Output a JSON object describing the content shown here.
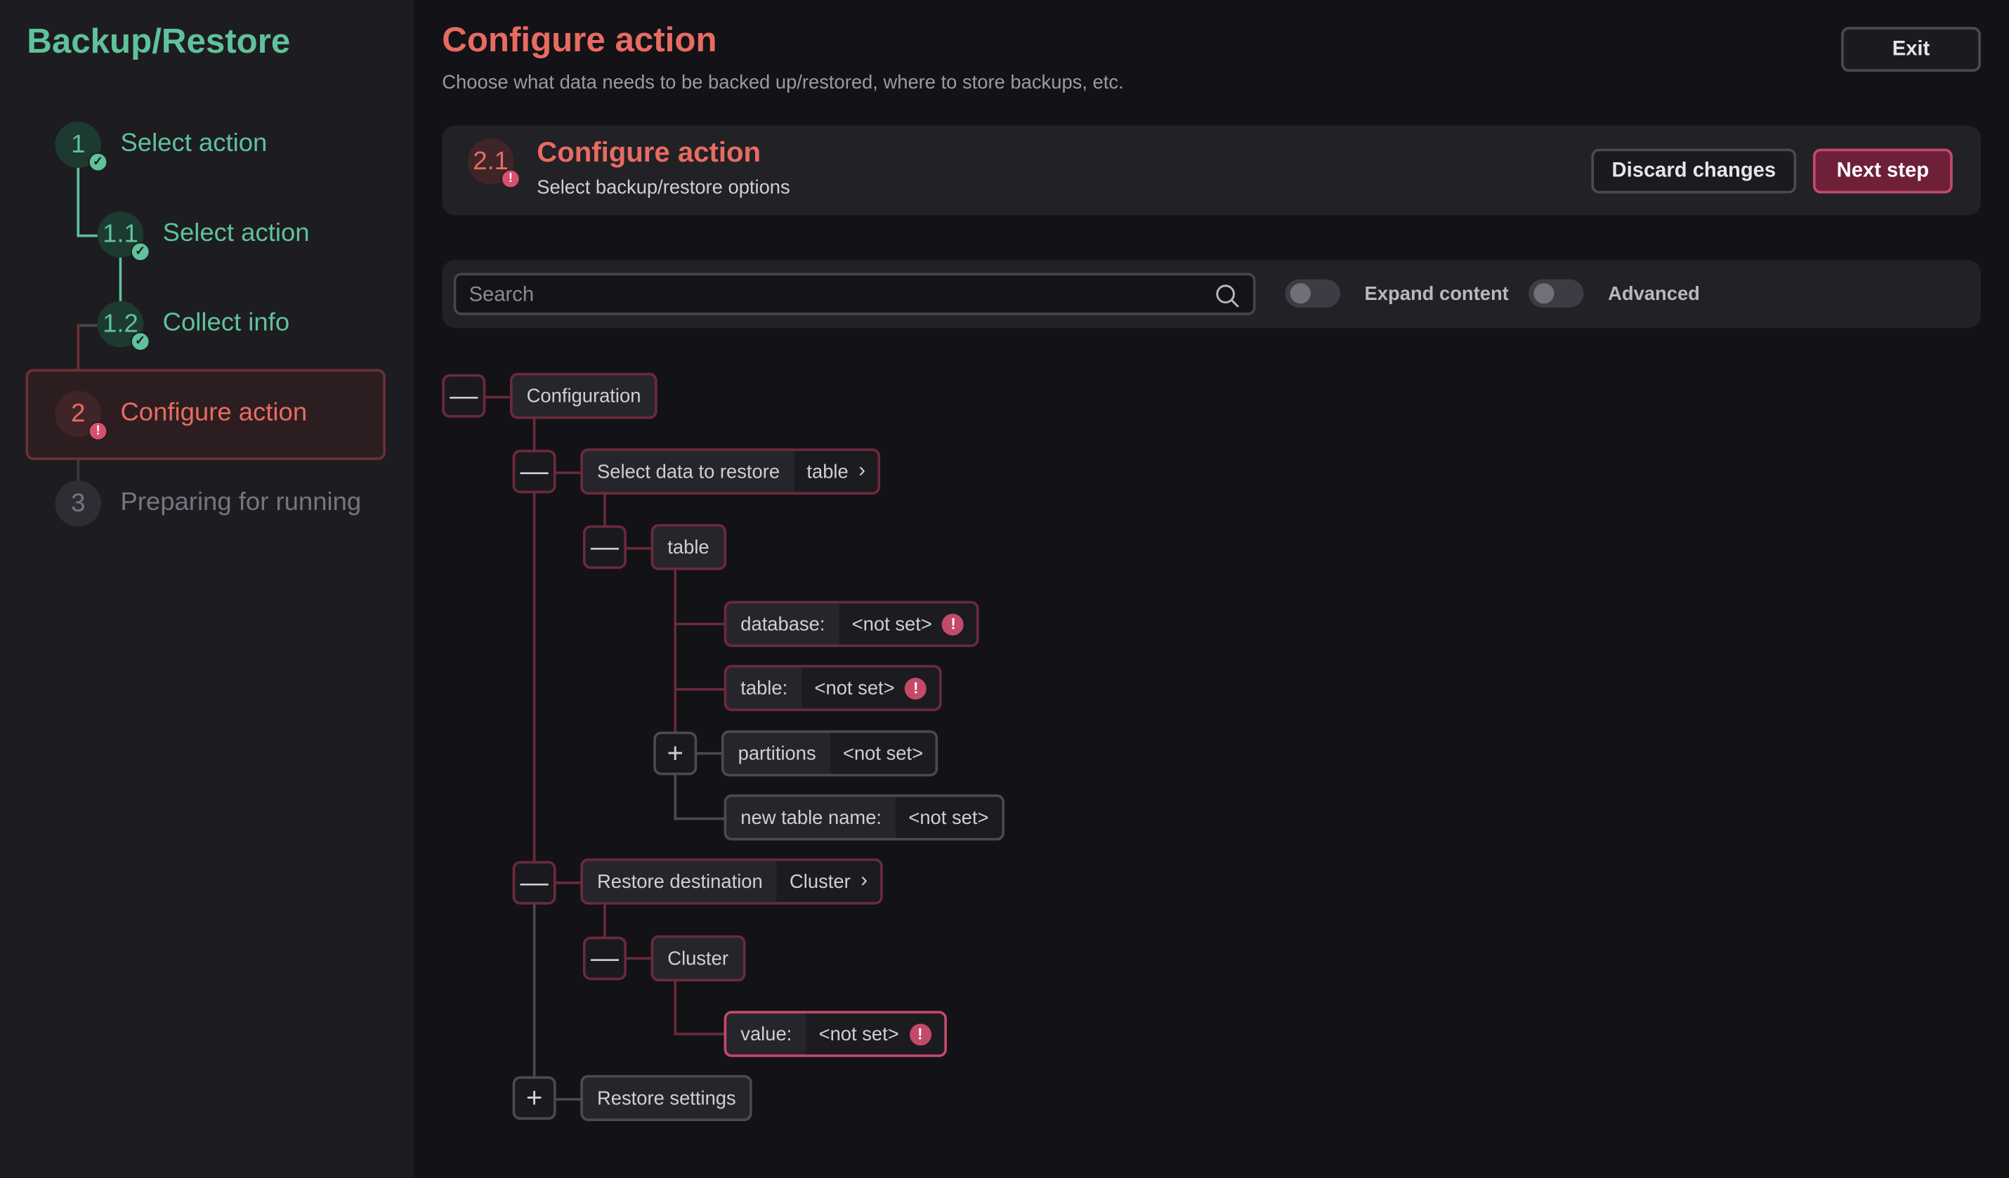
{
  "app": {
    "title": "Backup/Restore"
  },
  "sidebar": {
    "steps": [
      {
        "number": "1",
        "label": "Select action",
        "status": "done"
      },
      {
        "number": "1.1",
        "label": "Select action",
        "status": "done"
      },
      {
        "number": "1.2",
        "label": "Collect info",
        "status": "done"
      },
      {
        "number": "2",
        "label": "Configure action",
        "status": "error"
      },
      {
        "number": "3",
        "label": "Preparing for running",
        "status": "pending"
      }
    ]
  },
  "header": {
    "title": "Configure action",
    "subtitle": "Choose what data needs to be backed up/restored, where to store backups, etc.",
    "exit_label": "Exit"
  },
  "substep": {
    "number": "2.1",
    "title": "Configure action",
    "description": "Select backup/restore options",
    "discard_label": "Discard changes",
    "next_label": "Next step"
  },
  "toolbar": {
    "search_placeholder": "Search",
    "expand_label": "Expand content",
    "expand_on": false,
    "advanced_label": "Advanced",
    "advanced_on": false
  },
  "tree": {
    "collapse_symbol": "—",
    "expand_symbol": "+",
    "error_symbol": "!",
    "chevron": "›",
    "configuration": "Configuration",
    "select_data": {
      "label": "Select data to restore",
      "value": "table"
    },
    "table_node": "table",
    "database": {
      "label": "database:",
      "value": "<not set>"
    },
    "table_field": {
      "label": "table:",
      "value": "<not set>"
    },
    "partitions": {
      "label": "partitions",
      "value": "<not set>"
    },
    "new_table_name": {
      "label": "new table name:",
      "value": "<not set>"
    },
    "restore_destination": {
      "label": "Restore destination",
      "value": "Cluster"
    },
    "cluster_node": "Cluster",
    "value_field": {
      "label": "value:",
      "value": "<not set>"
    },
    "restore_settings": "Restore settings"
  },
  "colors": {
    "accent_green": "#5fc29a",
    "accent_red": "#e86b62",
    "primary_button": "#6e2038",
    "error_badge": "#c44a6a"
  }
}
